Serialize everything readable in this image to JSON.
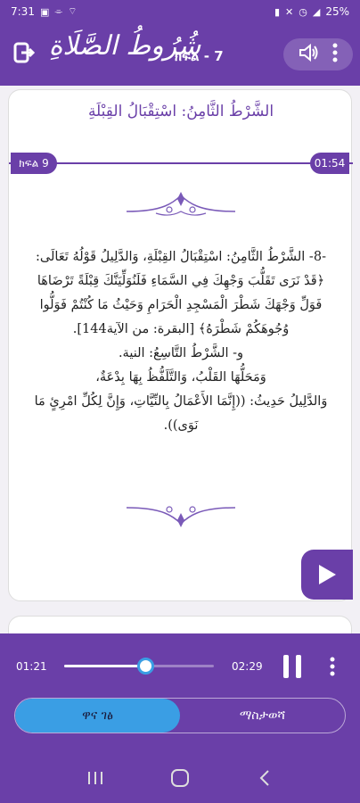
{
  "status_bar": {
    "time": "7:31",
    "battery": "25%",
    "left_icons": [
      "image-icon",
      "voicemail-icon",
      "wifi-icon"
    ],
    "right_icons": [
      "battery-saver-icon",
      "mute-icon",
      "alarm-icon",
      "signal-icon"
    ]
  },
  "app_bar": {
    "app_title": "شُرُوطُ الصَّلَاةِ",
    "lesson_label": "ክፍል - 7",
    "exit_icon": "exit-icon",
    "speaker_icon": "speaker-icon",
    "more_icon": "more-vert-icon"
  },
  "card": {
    "title": "الشَّرْطُ الثَّامِنُ: اسْتِقْبَالُ القِبْلَةِ",
    "badge_left": "ክፍል 9",
    "badge_right": "01:54",
    "paragraphs": [
      "-8- الشَّرْطُ الثَّامِنُ: اسْتِقْبَالُ القِبْلَةِ، وَالدَّلِيلُ قَوْلُهُ تَعَالَى: ﴿قَدْ نَرَى تَقَلُّبَ وَجْهِكَ فِي السَّمَاءِ فَلَنُوَلِّيَنَّكَ قِبْلَةً تَرْضَاهَا فَوَلِّ وَجْهَكَ شَطْرَ الْمَسْجِدِ الْحَرَامِ وَحَيْثُ مَا كُنْتُمْ فَوَلُّوا وُجُوهَكُمْ شَطْرَهُ﴾ [البقرة: من الآية144].",
      "و- الشَّرْطُ التَّاسِعُ: النية.",
      "وَمَحَلُّهَا القَلْبُ، وَالتَّلَفُّظُ بِهَا بِدْعَةٌ،",
      "وَالدَّلِيلُ حَدِيثُ: ((إِنَّمَا الأَعْمَالُ بِالنِّيَّاتِ، وَإِنَّ لِكُلِّ امْرِئٍ مَا نَوَى))."
    ],
    "play_icon": "play-icon"
  },
  "player": {
    "current_time": "01:21",
    "total_time": "02:29",
    "progress": 0.54,
    "pause_icon": "pause-icon",
    "more_icon": "more-vert-icon",
    "accent": "#3a9ee4",
    "primary": "#6a3fa8"
  },
  "tabs": {
    "main": "ዋና ገፅ",
    "notes": "ማስታወሻ"
  },
  "nav": {
    "recents_icon": "recents-icon",
    "home_icon": "home-icon",
    "back_icon": "back-icon"
  }
}
